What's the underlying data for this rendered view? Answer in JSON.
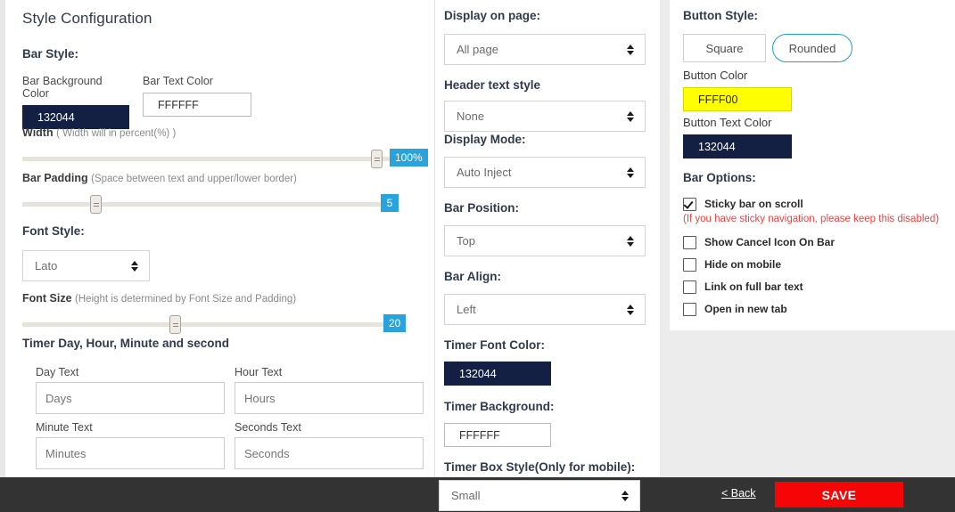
{
  "page": {
    "title": "Style Configuration"
  },
  "left": {
    "bar_style_heading": "Bar Style:",
    "bar_background_color_label": "Bar Background Color",
    "bar_background_color_value": "132044",
    "bar_text_color_label": "Bar Text Color",
    "bar_text_color_value": "FFFFFF",
    "width_label": "Width",
    "width_hint": "( Width will in percent(%) )",
    "width_value": "100%",
    "bar_padding_label": "Bar Padding",
    "bar_padding_hint": "(Space between text and upper/lower border)",
    "bar_padding_value": "5",
    "font_style_heading": "Font Style:",
    "font_family_selected": "Lato",
    "font_size_label": "Font Size",
    "font_size_hint": "(Height is determined by Font Size and Padding)",
    "font_size_value": "20",
    "timer_heading": "Timer Day, Hour, Minute and second",
    "day_text_label": "Day Text",
    "day_text_placeholder": "Days",
    "hour_text_label": "Hour Text",
    "hour_text_placeholder": "Hours",
    "minute_text_label": "Minute Text",
    "minute_text_placeholder": "Minutes",
    "seconds_text_label": "Seconds Text",
    "seconds_text_placeholder": "Seconds"
  },
  "middle": {
    "display_on_page_label": "Display on page:",
    "display_on_page_selected": "All page",
    "header_text_style_label": "Header text style",
    "header_text_style_selected": "None",
    "display_mode_label": "Display Mode:",
    "display_mode_selected": "Auto Inject",
    "bar_position_label": "Bar Position:",
    "bar_position_selected": "Top",
    "bar_align_label": "Bar Align:",
    "bar_align_selected": "Left",
    "timer_font_color_label": "Timer Font Color:",
    "timer_font_color_value": "132044",
    "timer_background_label": "Timer Background:",
    "timer_background_value": "FFFFFF",
    "timer_box_style_label": "Timer Box Style(Only for mobile):",
    "timer_box_style_selected": "Small"
  },
  "right": {
    "button_style_heading": "Button Style:",
    "style_square_label": "Square",
    "style_rounded_label": "Rounded",
    "button_color_label": "Button Color",
    "button_color_value": "FFFF00",
    "button_text_color_label": "Button Text Color",
    "button_text_color_value": "132044",
    "bar_options_heading": "Bar Options:",
    "options": [
      {
        "label": "Sticky bar on scroll",
        "checked": true,
        "note": "(If you have sticky navigation, please keep this disabled)"
      },
      {
        "label": "Show Cancel Icon On Bar",
        "checked": false,
        "note": ""
      },
      {
        "label": "Hide on mobile",
        "checked": false,
        "note": ""
      },
      {
        "label": "Link on full bar text",
        "checked": false,
        "note": ""
      },
      {
        "label": "Open in new tab",
        "checked": false,
        "note": ""
      }
    ]
  },
  "footer": {
    "back_label": "< Back",
    "save_label": "SAVE"
  },
  "colors": {
    "navy": "#132044",
    "yellow": "#FFFF00",
    "accent_blue": "#29a3dd",
    "rounded_border": "#1f9fd8",
    "save_red": "#f50505",
    "warn_red": "#ff3b3b",
    "footer_dark": "#333333",
    "page_gray": "#ececec"
  }
}
